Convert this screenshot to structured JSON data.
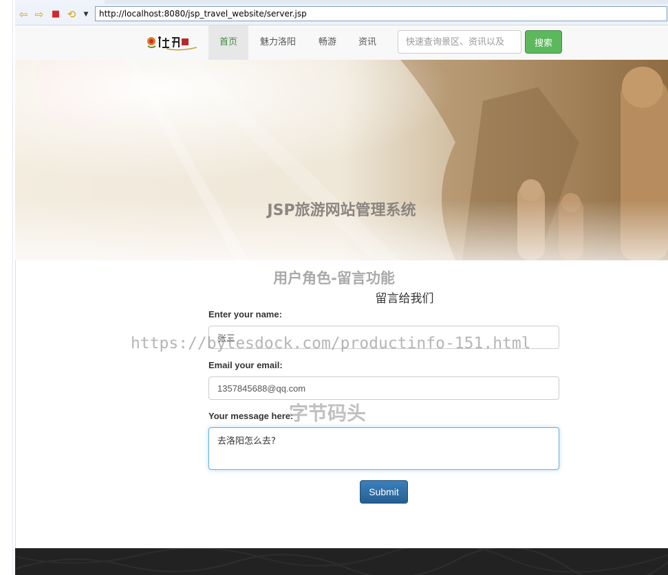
{
  "browser": {
    "url": "http://localhost:8080/jsp_travel_website/server.jsp"
  },
  "nav": {
    "items": [
      {
        "label": "首页",
        "active": true
      },
      {
        "label": "魅力洛阳",
        "active": false
      },
      {
        "label": "畅游",
        "active": false
      },
      {
        "label": "资讯",
        "active": false
      }
    ],
    "search_placeholder": "快速查询景区、资讯以及",
    "search_button": "搜索"
  },
  "banner": {
    "caption": "JSP旅游网站管理系统"
  },
  "content": {
    "subtitle": "用户角色-留言功能",
    "form_heading": "留言给我们",
    "name_label": "Enter your name:",
    "name_value": "张三",
    "email_label": "Email your email:",
    "email_value": "1357845688@qq.com",
    "message_label": "Your message here:",
    "message_value": "去洛阳怎么去?",
    "submit_label": "Submit"
  },
  "watermarks": {
    "url": "https://bytesdock.com/productinfo-151.html",
    "brand": "字节码头"
  },
  "colors": {
    "active_nav_text": "#3c8a3c",
    "search_button": "#5cb85c",
    "submit_button": "#286090",
    "footer": "#222222"
  }
}
